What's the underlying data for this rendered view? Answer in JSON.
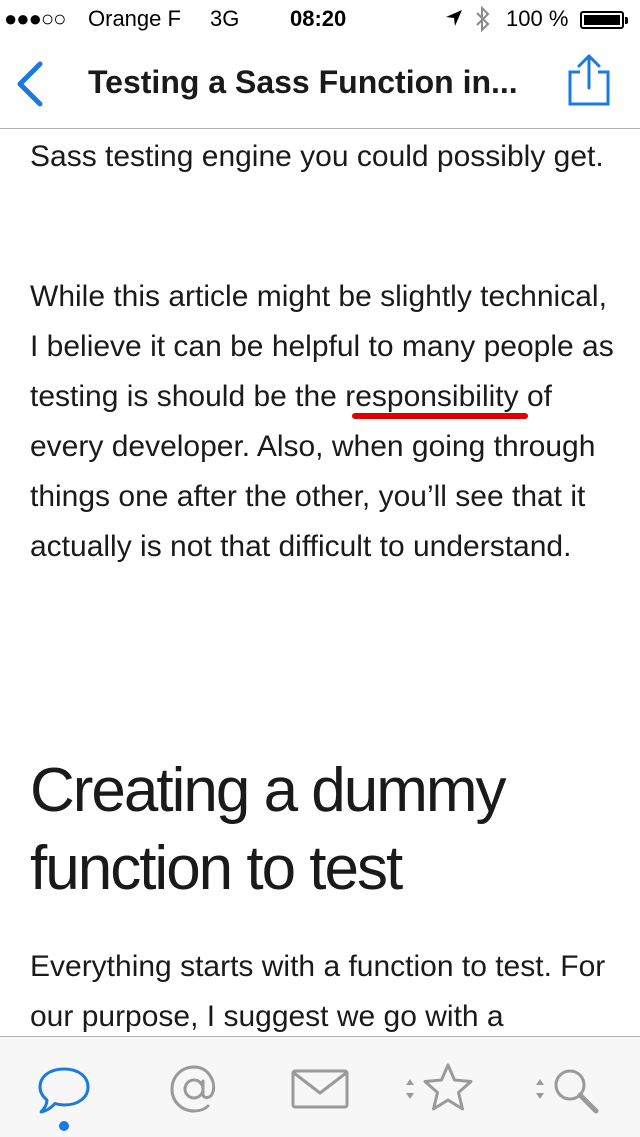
{
  "status_bar": {
    "signal": "●●●○○",
    "carrier": "Orange F",
    "network": "3G",
    "time": "08:20",
    "battery": "100 %"
  },
  "nav": {
    "title": "Testing a Sass Function in...",
    "back_icon": "chevron-left-icon",
    "share_icon": "share-icon"
  },
  "article": {
    "para1": "Sass testing engine you could possibly get.",
    "para2": "While this article might be slightly technical, I believe it can be helpful to many people as testing is should be the responsibility of every developer. Also, when going through things one after the other, you’ll see that it actually is not that difficult to understand.",
    "heading": "Creating a dummy function to test",
    "para3": "Everything starts with a function to test. For our purpose, I suggest we go with a"
  },
  "tabs": [
    {
      "icon": "speech-bubble-icon",
      "active": true
    },
    {
      "icon": "at-sign-icon",
      "active": false
    },
    {
      "icon": "envelope-icon",
      "active": false
    },
    {
      "icon": "star-icon",
      "active": false
    },
    {
      "icon": "search-icon",
      "active": false
    }
  ],
  "colors": {
    "accent": "#1a7ae0",
    "annotation": "#e00000",
    "icon_inactive": "#9a9a9a"
  }
}
